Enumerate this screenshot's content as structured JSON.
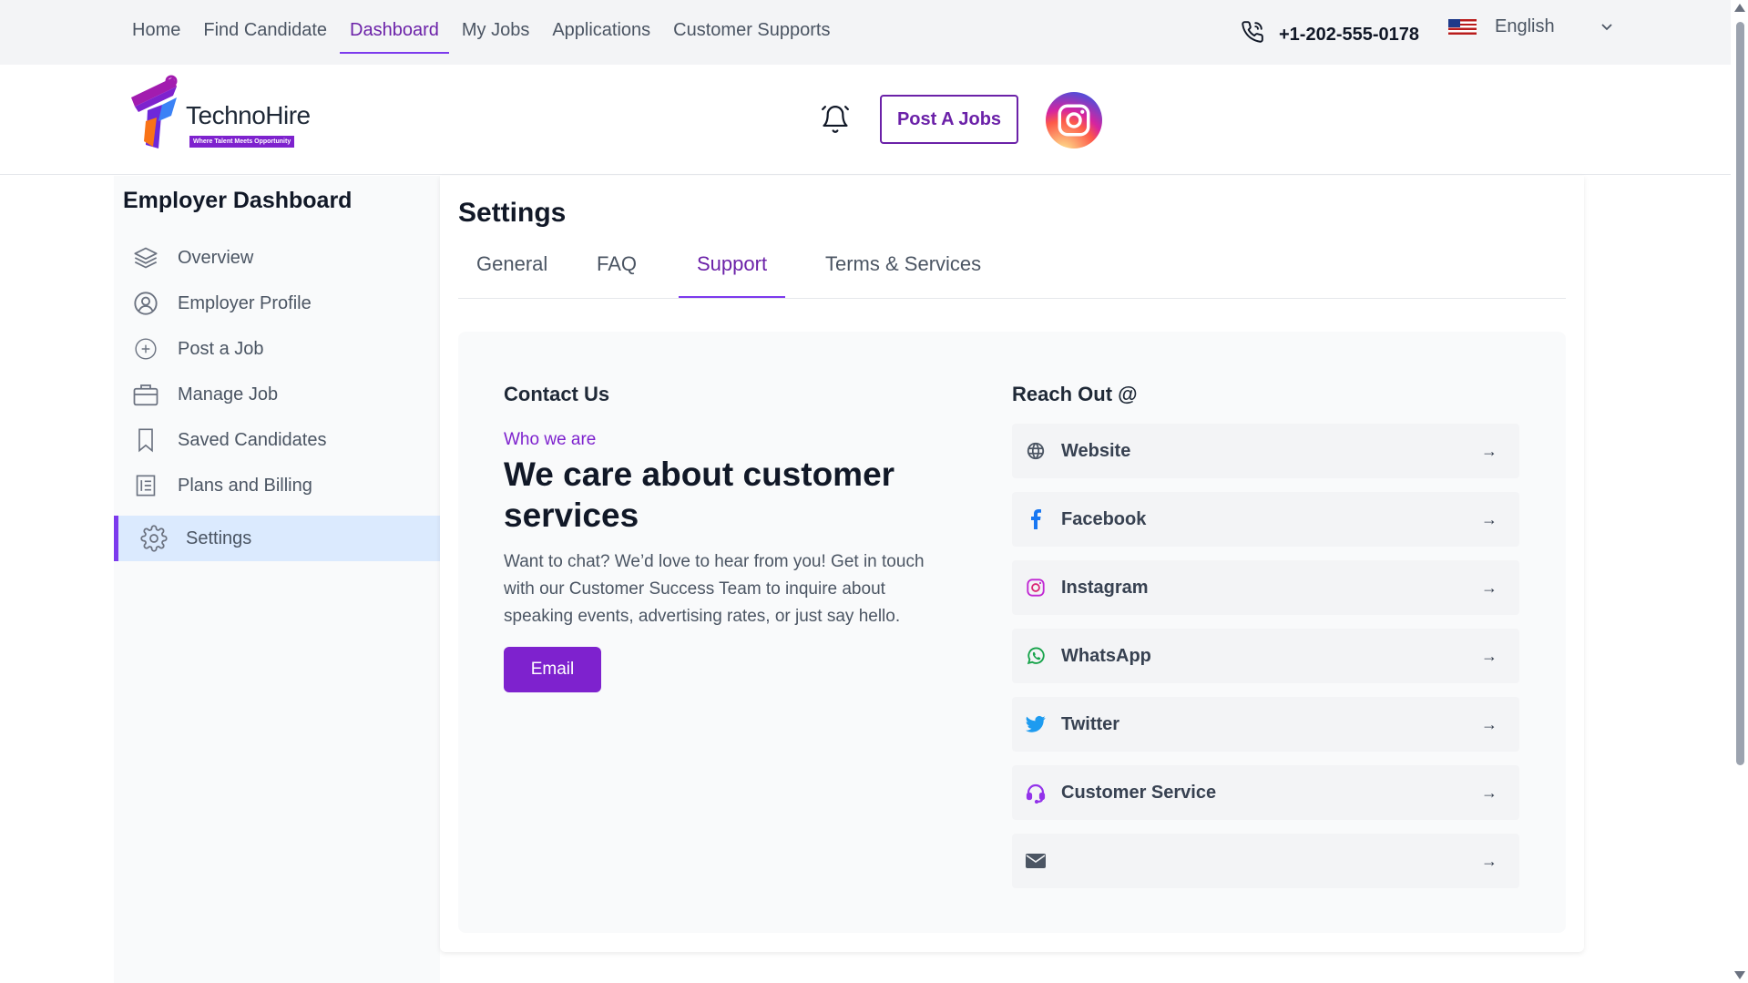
{
  "topnav": {
    "items": [
      {
        "label": "Home"
      },
      {
        "label": "Find Candidate"
      },
      {
        "label": "Dashboard",
        "active": true
      },
      {
        "label": "My Jobs"
      },
      {
        "label": "Applications"
      },
      {
        "label": "Customer Supports"
      }
    ],
    "phone": "+1-202-555-0178",
    "language": "English",
    "phone_icon": "phone-icon",
    "flag_icon": "us-flag-icon"
  },
  "header": {
    "logo_name": "TechnoHire",
    "logo_tagline": "Where Talent Meets Opportunity",
    "post_button": "Post A Jobs",
    "bell_icon": "bell-icon",
    "avatar_icon": "instagram-logo-icon"
  },
  "sidebar": {
    "title": "Employer Dashboard",
    "items": [
      {
        "label": "Overview",
        "icon": "layers-icon"
      },
      {
        "label": "Employer Profile",
        "icon": "user-circle-icon"
      },
      {
        "label": "Post a Job",
        "icon": "plus-circle-icon"
      },
      {
        "label": "Manage Job",
        "icon": "briefcase-icon"
      },
      {
        "label": "Saved Candidates",
        "icon": "bookmark-icon"
      },
      {
        "label": "Plans and Billing",
        "icon": "document-icon"
      },
      {
        "label": "Settings",
        "icon": "gear-icon",
        "active": true
      }
    ]
  },
  "settings": {
    "title": "Settings",
    "tabs": [
      {
        "label": "General"
      },
      {
        "label": "FAQ"
      },
      {
        "label": "Support",
        "active": true
      },
      {
        "label": "Terms & Services"
      }
    ]
  },
  "support": {
    "contact_title": "Contact Us",
    "who_label": "Who we are",
    "headline": "We care about customer services",
    "description": "Want to chat? We’d love to hear from you! Get in touch with our Customer Success Team to inquire about speaking events, advertising rates, or just say hello.",
    "email_button": "Email",
    "reach_title": "Reach Out @",
    "reach_items": [
      {
        "label": "Website",
        "icon": "globe-icon",
        "arrow": "→"
      },
      {
        "label": "Facebook",
        "icon": "facebook-icon",
        "arrow": "→"
      },
      {
        "label": "Instagram",
        "icon": "instagram-icon",
        "arrow": "→"
      },
      {
        "label": "WhatsApp",
        "icon": "whatsapp-icon",
        "arrow": "→"
      },
      {
        "label": "Twitter",
        "icon": "twitter-icon",
        "arrow": "→"
      },
      {
        "label": "Customer Service",
        "icon": "headset-icon",
        "arrow": "→"
      },
      {
        "label": "",
        "icon": "envelope-icon",
        "arrow": "→"
      }
    ]
  },
  "colors": {
    "accent": "#7e22ce",
    "active_sidebar_bg": "#dbeafe",
    "topbar_bg": "#f3f4f6"
  }
}
